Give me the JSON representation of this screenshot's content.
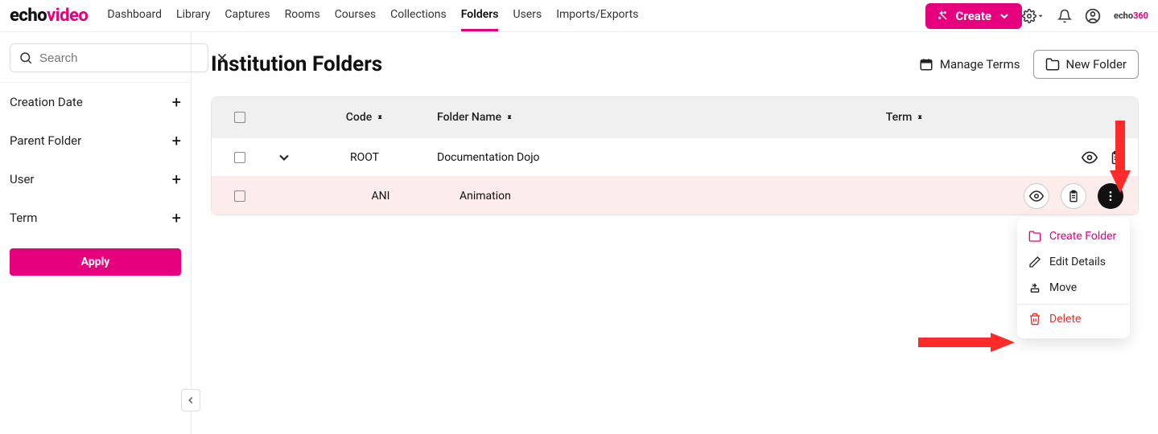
{
  "brand": {
    "echo": "echo",
    "video": "video",
    "echo360_prefix": "echo",
    "echo360_suffix": "360"
  },
  "nav": {
    "items": [
      {
        "label": "Dashboard"
      },
      {
        "label": "Library"
      },
      {
        "label": "Captures"
      },
      {
        "label": "Rooms"
      },
      {
        "label": "Courses"
      },
      {
        "label": "Collections"
      },
      {
        "label": "Folders"
      },
      {
        "label": "Users"
      },
      {
        "label": "Imports/Exports"
      }
    ],
    "create_label": "Create"
  },
  "sidebar": {
    "search_placeholder": "Search",
    "filters": [
      {
        "label": "Creation Date"
      },
      {
        "label": "Parent Folder"
      },
      {
        "label": "User"
      },
      {
        "label": "Term"
      }
    ],
    "apply_label": "Apply"
  },
  "main": {
    "title": "Institution Folders",
    "manage_terms_label": "Manage Terms",
    "new_folder_label": "New Folder",
    "table": {
      "headers": {
        "code": "Code",
        "folder_name": "Folder Name",
        "term": "Term"
      },
      "rows": [
        {
          "code": "ROOT",
          "name": "Documentation Dojo",
          "expandable": true
        },
        {
          "code": "ANI",
          "name": "Animation",
          "expandable": false
        }
      ]
    }
  },
  "dropdown": {
    "create_folder": "Create Folder",
    "edit_details": "Edit Details",
    "move": "Move",
    "delete": "Delete"
  }
}
